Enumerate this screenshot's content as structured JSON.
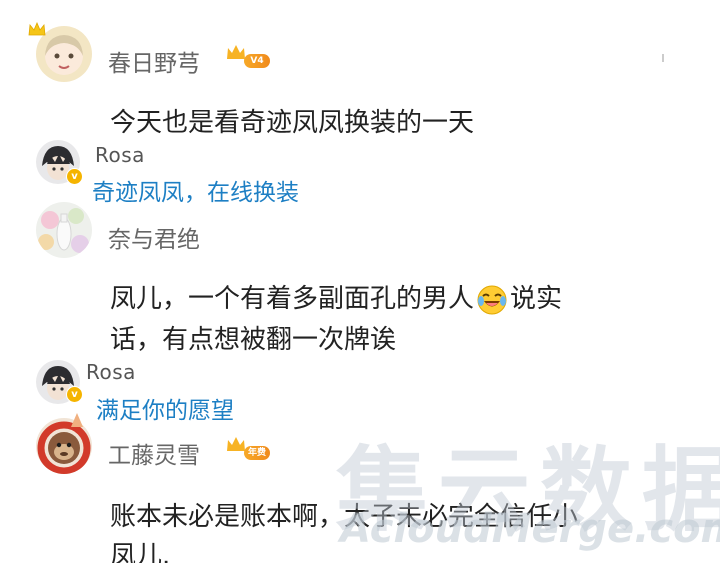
{
  "comments": [
    {
      "username": "春日野芎",
      "badge": "V4",
      "content_lines": [
        "今天也是看奇迹凤凤换装的一天"
      ],
      "reply": {
        "username": "Rosa",
        "text": "奇迹凤凤，在线换装"
      }
    },
    {
      "username": "奈与君绝",
      "content_lines": [
        "凤儿，一个有着多副面孔的男人",
        "说实",
        "话，有点想被翻一次牌诶"
      ],
      "reply": {
        "username": "Rosa",
        "text": "满足你的愿望"
      }
    },
    {
      "username": "工藤灵雪",
      "badge": "年费",
      "content_lines": [
        "账本未必是账本啊，太子未必完全信任小",
        "凤儿."
      ]
    }
  ],
  "watermark": {
    "cn": "集云数据",
    "en": "AcloudMerge.com"
  },
  "colors": {
    "reply_blue": "#1d7fc4",
    "badge_orange": "#f7a928",
    "verified_yellow": "#f5b400"
  },
  "icons": {
    "crown": "crown-icon",
    "verified": "verified-v-icon",
    "emoji": "laughing-tears-emoji"
  }
}
